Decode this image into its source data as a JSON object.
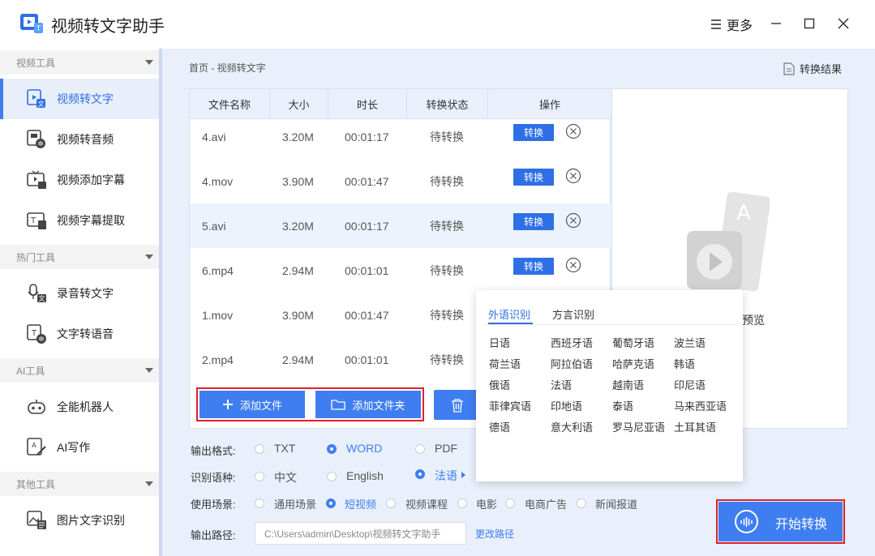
{
  "app": {
    "title": "视频转文字助手",
    "more_label": "更多"
  },
  "colors": {
    "accent": "#3f7ef0",
    "highlight_border": "#e0202a"
  },
  "sidebar": {
    "categories": [
      {
        "label": "视频工具"
      },
      {
        "label": "热门工具"
      },
      {
        "label": "AI工具"
      },
      {
        "label": "其他工具"
      }
    ],
    "items": [
      {
        "label": "视频转文字",
        "icon": "video-to-text-icon",
        "active": true
      },
      {
        "label": "视频转音频",
        "icon": "video-to-audio-icon"
      },
      {
        "label": "视频添加字幕",
        "icon": "add-subtitle-icon"
      },
      {
        "label": "视频字幕提取",
        "icon": "extract-subtitle-icon"
      },
      {
        "label": "录音转文字",
        "icon": "recording-to-text-icon"
      },
      {
        "label": "文字转语音",
        "icon": "text-to-speech-icon"
      },
      {
        "label": "全能机器人",
        "icon": "robot-icon"
      },
      {
        "label": "AI写作",
        "icon": "ai-writing-icon"
      },
      {
        "label": "图片文字识别",
        "icon": "image-ocr-icon"
      }
    ]
  },
  "main": {
    "breadcrumb": "首页 - 视频转文字",
    "result_link": "转换结果",
    "table": {
      "headers": [
        "文件名称",
        "大小",
        "时长",
        "转换状态",
        "操作"
      ],
      "convert_label": "转换",
      "rows": [
        {
          "name": "4.avi",
          "size": "3.20M",
          "duration": "00:01:17",
          "status": "待转换"
        },
        {
          "name": "4.mov",
          "size": "3.90M",
          "duration": "00:01:47",
          "status": "待转换"
        },
        {
          "name": "5.avi",
          "size": "3.20M",
          "duration": "00:01:17",
          "status": "待转换",
          "selected": true
        },
        {
          "name": "6.mp4",
          "size": "2.94M",
          "duration": "00:01:01",
          "status": "待转换"
        },
        {
          "name": "1.mov",
          "size": "3.90M",
          "duration": "00:01:47",
          "status": "待转换"
        },
        {
          "name": "2.mp4",
          "size": "2.94M",
          "duration": "00:01:01",
          "status": "待转换"
        }
      ]
    },
    "add_file_label": "添加文件",
    "add_folder_label": "添加文件夹",
    "preview_label": "预览"
  },
  "options": {
    "output_format": {
      "label": "输出格式:",
      "choices": [
        "TXT",
        "WORD",
        "PDF"
      ],
      "selected": "WORD"
    },
    "language": {
      "label": "识别语种:",
      "choices": [
        "中文",
        "English",
        "法语"
      ],
      "selected": "法语"
    },
    "scene": {
      "label": "使用场景:",
      "choices": [
        "通用场景",
        "短视频",
        "视频课程",
        "电影",
        "电商广告",
        "新闻报道"
      ],
      "selected": "短视频"
    },
    "output_path": {
      "label": "输出路径:",
      "value": "C:\\Users\\admin\\Desktop\\视频转文字助手",
      "change_label": "更改路径"
    },
    "start_label": "开始转换"
  },
  "lang_popup": {
    "tabs": [
      "外语识别",
      "方言识别"
    ],
    "active_tab": "外语识别",
    "languages": [
      "日语",
      "西班牙语",
      "葡萄牙语",
      "波兰语",
      "荷兰语",
      "阿拉伯语",
      "哈萨克语",
      "韩语",
      "俄语",
      "法语",
      "越南语",
      "印尼语",
      "菲律宾语",
      "印地语",
      "泰语",
      "马来西亚语",
      "德语",
      "意大利语",
      "罗马尼亚语",
      "土耳其语"
    ]
  }
}
